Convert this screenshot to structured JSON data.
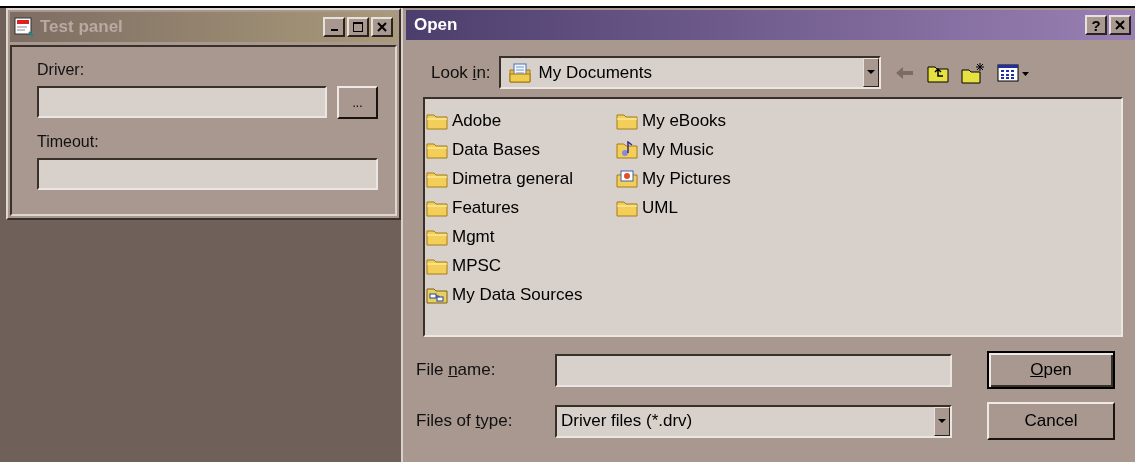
{
  "test_panel": {
    "title": "Test panel",
    "active": false,
    "fields": [
      {
        "label": "Driver:",
        "browse": "..."
      },
      {
        "label": "Timeout:"
      }
    ]
  },
  "open_dialog": {
    "title": "Open",
    "help": "?",
    "look_in": {
      "label": {
        "before": "Look ",
        "key": "i",
        "after": "n:"
      },
      "value": "My Documents"
    },
    "files": [
      {
        "name": "Adobe",
        "kind": "folder"
      },
      {
        "name": "Data Bases",
        "kind": "folder"
      },
      {
        "name": "Dimetra general",
        "kind": "folder"
      },
      {
        "name": "Features",
        "kind": "folder"
      },
      {
        "name": "Mgmt",
        "kind": "folder"
      },
      {
        "name": "MPSC",
        "kind": "folder"
      },
      {
        "name": "My Data Sources",
        "kind": "datasource"
      },
      {
        "name": "My eBooks",
        "kind": "folder"
      },
      {
        "name": "My Music",
        "kind": "music"
      },
      {
        "name": "My Pictures",
        "kind": "pictures"
      },
      {
        "name": "UML",
        "kind": "folder"
      }
    ],
    "file_name": {
      "label": {
        "before": "File ",
        "key": "n",
        "after": "ame:"
      }
    },
    "file_type": {
      "label": {
        "before": "Files of ",
        "key": "t",
        "after": "ype:"
      },
      "value": "Driver files (*.drv)"
    },
    "buttons": [
      {
        "label": {
          "key": "O",
          "after": "pen"
        },
        "default": true
      },
      {
        "label": {
          "before": "Cancel"
        },
        "default": false
      }
    ]
  }
}
